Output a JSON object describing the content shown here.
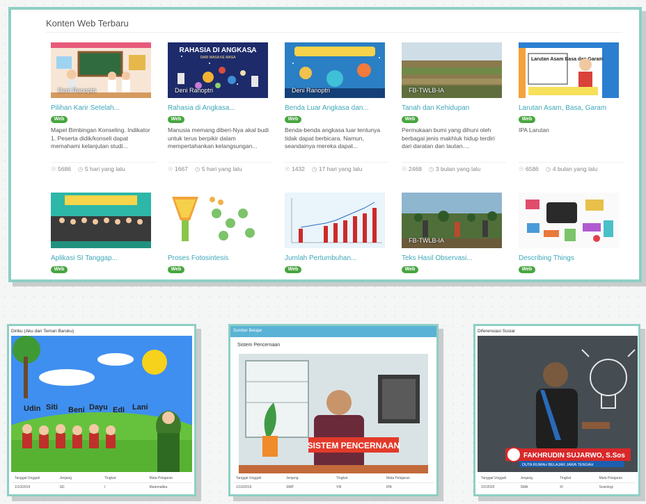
{
  "section": {
    "title": "Konten Web Terbaru"
  },
  "badge_label": "Web",
  "cards_row1": [
    {
      "title": "Pilihan Karir Setelah...",
      "caption": "Deni Ranoptri",
      "desc": "Mapel Bimbingan Konseling. Indikator 1. Peserta didik/konseli dapat memahami kelanjutan studi...",
      "views": "5686",
      "time": "5 hari yang lalu"
    },
    {
      "title": "Rahasia di Angkasa...",
      "caption": "Deni Ranoptri",
      "desc": "Manusia memang diberi-Nya akal budi untuk terus berpikir dalam mempertahankan kelangsungan...",
      "views": "1667",
      "time": "5 hari yang lalu",
      "thumb_heading": "RAHASIA DI ANGKASA",
      "thumb_sub": "DARI MASA KE MASA"
    },
    {
      "title": "Benda Luar Angkasa dan...",
      "caption": "Deni Ranoptri",
      "desc": "Benda-benda angkasa luar tentunya tidak dapat berbicara. Namun, seandainya mereka dapat...",
      "views": "1432",
      "time": "17 hari yang lalu"
    },
    {
      "title": "Tanah dan Kehidupan",
      "caption": "FB-TWLB-IA",
      "desc": "Permukaan bumi yang dihuni oleh berbagai jenis makhluk hidup terdiri dari daratan dan lautan....",
      "views": "2468",
      "time": "3 bulan yang lalu"
    },
    {
      "title": "Larutan Asam, Basa, Garam",
      "caption": "",
      "desc": "IPA Larutan",
      "views": "6586",
      "time": "4 bulan yang lalu",
      "thumb_heading": "Larutan Asam Basa dan Garam"
    }
  ],
  "cards_row2": [
    {
      "title": "Aplikasi SI Tanggap..."
    },
    {
      "title": "Proses Fotosintesis"
    },
    {
      "title": "Jumlah Pertumbuhan..."
    },
    {
      "title": "Teks Hasil Observasi...",
      "caption": "FB-TWLB-IA"
    },
    {
      "title": "Describing Things"
    }
  ],
  "bottom_panels": [
    {
      "title": "Diriku (Aku dan Teman Baruku)",
      "names": [
        "Udin",
        "Siti",
        "Beni",
        "Dayu",
        "Edi",
        "Lani"
      ],
      "footer_labels": [
        "Tanggal Unggah",
        "Jenjang",
        "Tingkat",
        "Mata Pelajaran"
      ],
      "footer_values": [
        "1/10/2019",
        "SD",
        "I",
        "Matematika"
      ]
    },
    {
      "title": "Sistem Pencernaan",
      "header": "Sumber Belajar",
      "banner": "SISTEM PENCERNAAN",
      "footer_labels": [
        "Tanggal Unggah",
        "Jenjang",
        "Tingkat",
        "Mata Pelajaran"
      ],
      "footer_values": [
        "1/10/2019",
        "SMP",
        "VIII",
        "IPA"
      ]
    },
    {
      "title": "Diferensiasi Sosial",
      "name_banner": "FAKHRUDIN SUJARWO, S.Sos",
      "subtitle": "DUTA RUMAH BELAJAR JAWA TENGAH",
      "footer_labels": [
        "Tanggal Unggah",
        "Jenjang",
        "Tingkat",
        "Mata Pelajaran"
      ],
      "footer_values": [
        "2/2/2020",
        "SMA",
        "XI",
        "Sosiologi"
      ]
    }
  ],
  "icons": {
    "views": "eye-icon",
    "time": "clock-icon"
  },
  "colors": {
    "accent_border": "#8ecfc4",
    "title_link": "#3ea7b9",
    "badge_green": "#48a53f",
    "header_blue": "#5ab3d6"
  }
}
